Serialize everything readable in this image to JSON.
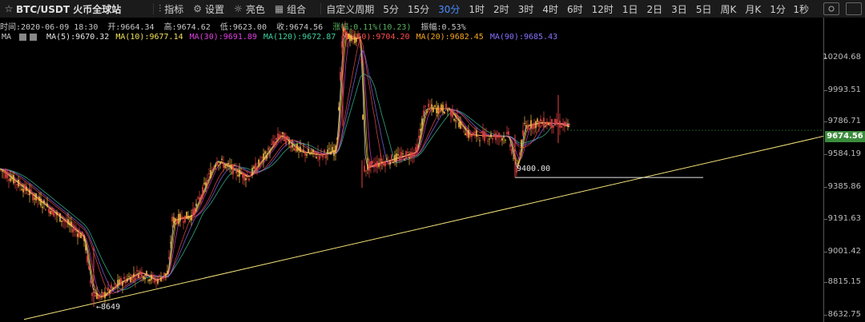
{
  "toolbar": {
    "symbol": "BTC/USDT 火币全球站",
    "indicators": "指标",
    "settings": "设置",
    "brightness": "亮色",
    "combo": "组合",
    "custom_period": "自定义周期",
    "timeframes": [
      "5分",
      "15分",
      "30分",
      "1时",
      "2时",
      "3时",
      "4时",
      "6时",
      "12时",
      "1日",
      "2日",
      "3日",
      "5日",
      "周K",
      "月K",
      "1分"
    ],
    "active_timeframe": "30分",
    "clock_label": "1秒"
  },
  "info": {
    "time": "时间:2020-06-09 18:30",
    "open": "开:9664.34",
    "high": "高:9674.62",
    "low": "低:9623.00",
    "close": "收:9674.56",
    "change": "涨幅:0.11%(10.23)",
    "amplitude": "振幅:0.53%"
  },
  "ma": {
    "label": "MA",
    "items": [
      {
        "text": "MA(5):9670.32",
        "color": "#e6e6e6"
      },
      {
        "text": "MA(10):9677.14",
        "color": "#f0e05a"
      },
      {
        "text": "MA(30):9691.89",
        "color": "#e040e0"
      },
      {
        "text": "MA(120):9672.87",
        "color": "#40d0a0"
      },
      {
        "text": "MA(60):9704.20",
        "color": "#ff5050"
      },
      {
        "text": "MA(20):9682.45",
        "color": "#f5a623"
      },
      {
        "text": "MA(90):9685.43",
        "color": "#8a70ff"
      }
    ]
  },
  "axis": {
    "ticks": [
      "10204.68",
      "9993.51",
      "9786.71",
      "9584.19",
      "9385.86",
      "9191.63",
      "9001.42",
      "8815.15",
      "8632.75"
    ],
    "current_price": "9674.56"
  },
  "annotations": {
    "low_label": "←8649",
    "support_label": "9400.00"
  },
  "chart_data": {
    "type": "candlestick",
    "price_range": [
      8632.75,
      10204.68
    ],
    "low_marker": 8649,
    "support_level": 9400.0,
    "last_price": 9674.56,
    "trendline_color": "#f5e27a",
    "up_color": "#f5b942",
    "down_color": "#e84343"
  }
}
